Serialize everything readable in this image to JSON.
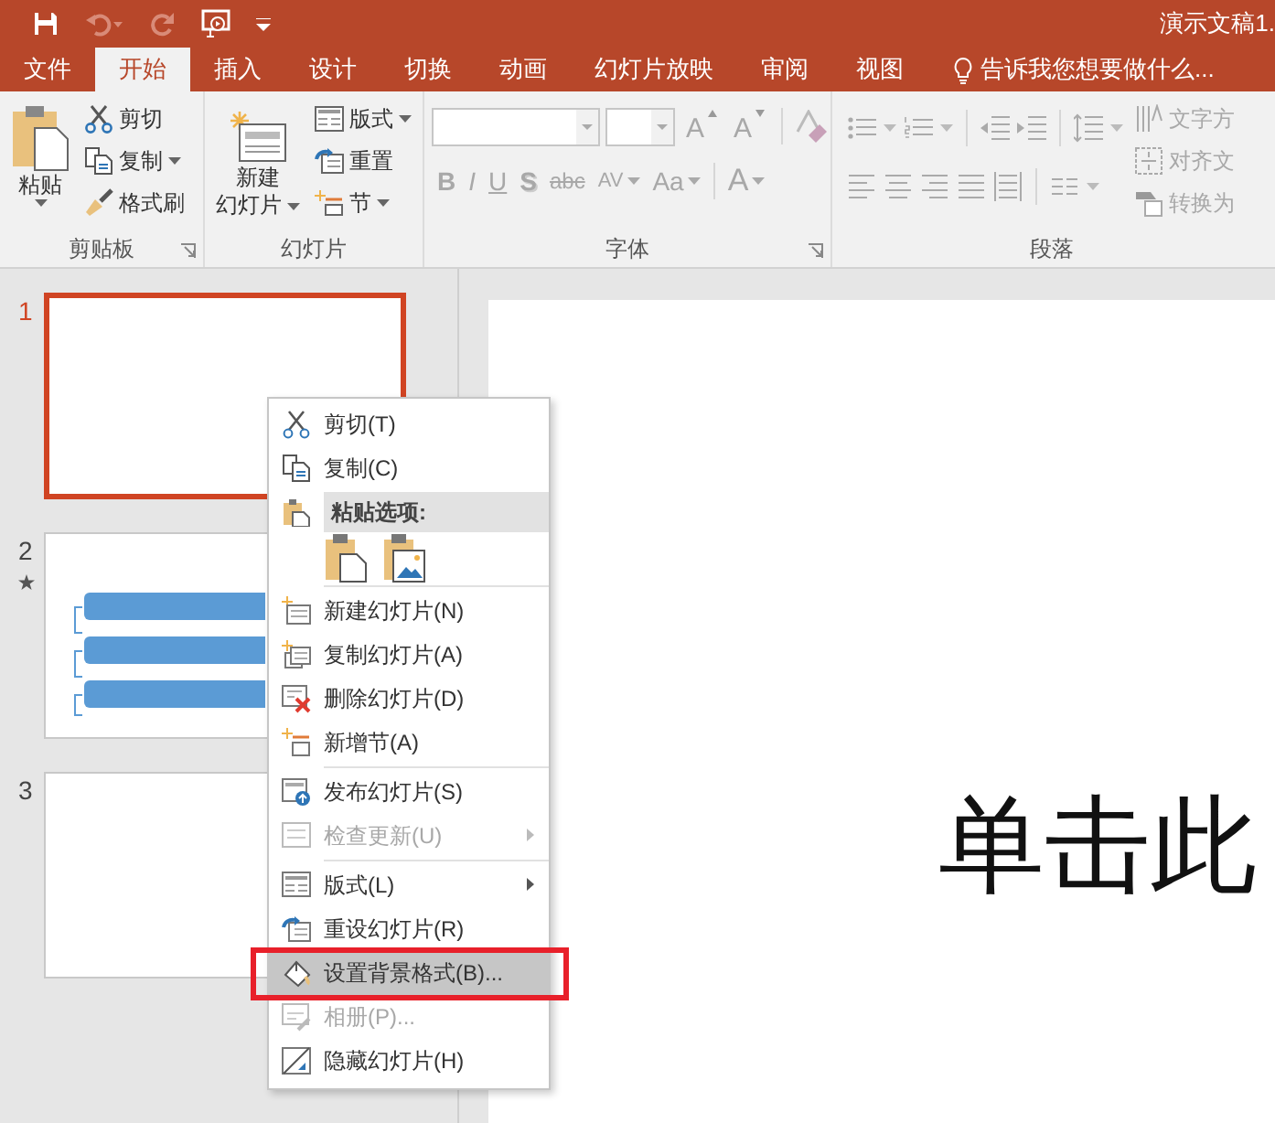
{
  "title_bar": {
    "title": "演示文稿1."
  },
  "tabs": [
    {
      "label": "文件",
      "selected": false
    },
    {
      "label": "开始",
      "selected": true
    },
    {
      "label": "插入",
      "selected": false
    },
    {
      "label": "设计",
      "selected": false
    },
    {
      "label": "切换",
      "selected": false
    },
    {
      "label": "动画",
      "selected": false
    },
    {
      "label": "幻灯片放映",
      "selected": false
    },
    {
      "label": "审阅",
      "selected": false
    },
    {
      "label": "视图",
      "selected": false
    }
  ],
  "tell_me": {
    "placeholder": "告诉我您想要做什么..."
  },
  "ribbon": {
    "clipboard": {
      "label": "剪贴板",
      "paste": "粘贴",
      "buttons": [
        {
          "label": "剪切",
          "dropdown": false
        },
        {
          "label": "复制",
          "dropdown": true
        },
        {
          "label": "格式刷",
          "dropdown": false
        }
      ]
    },
    "slides": {
      "label": "幻灯片",
      "new_slide": [
        "新建",
        "幻灯片"
      ],
      "buttons": [
        {
          "label": "版式",
          "dropdown": true
        },
        {
          "label": "重置",
          "dropdown": false
        },
        {
          "label": "节",
          "dropdown": true
        }
      ]
    },
    "font": {
      "label": "字体",
      "disabled": true,
      "size_buttons": [
        {
          "label": "A",
          "kind": "grow"
        },
        {
          "label": "A",
          "kind": "shrink"
        }
      ],
      "format_buttons": [
        {
          "label": "B",
          "kind": "bold"
        },
        {
          "label": "I",
          "kind": "italic"
        },
        {
          "label": "U",
          "kind": "underline"
        },
        {
          "label": "S",
          "kind": "shadow"
        },
        {
          "label": "abc",
          "kind": "strike"
        },
        {
          "label": "AV",
          "kind": "spacing"
        },
        {
          "label": "Aa",
          "kind": "case"
        },
        {
          "label": "A",
          "kind": "color"
        }
      ]
    },
    "paragraph": {
      "label": "段落",
      "disabled": true,
      "buttons": [
        {
          "label": "文字方"
        },
        {
          "label": "对齐文"
        },
        {
          "label": "转换为"
        }
      ]
    }
  },
  "slides_pane": [
    {
      "number": "1",
      "selected": true,
      "animated": false,
      "kind": "blank"
    },
    {
      "number": "2",
      "selected": false,
      "animated": true,
      "kind": "diagram"
    },
    {
      "number": "3",
      "selected": false,
      "animated": false,
      "kind": "blank"
    }
  ],
  "slide": {
    "placeholder": "单击此"
  },
  "context_menu": [
    {
      "kind": "item",
      "label": "剪切(T)",
      "disabled": false,
      "selected": false,
      "outlined": false,
      "submenu": false
    },
    {
      "kind": "item",
      "label": "复制(C)",
      "disabled": false,
      "selected": false,
      "outlined": false,
      "submenu": false
    },
    {
      "kind": "header",
      "label": "粘贴选项:"
    },
    {
      "kind": "paste-options"
    },
    {
      "kind": "separator"
    },
    {
      "kind": "item",
      "label": "新建幻灯片(N)",
      "disabled": false,
      "selected": false,
      "outlined": false,
      "submenu": false
    },
    {
      "kind": "item",
      "label": "复制幻灯片(A)",
      "disabled": false,
      "selected": false,
      "outlined": false,
      "submenu": false
    },
    {
      "kind": "item",
      "label": "删除幻灯片(D)",
      "disabled": false,
      "selected": false,
      "outlined": false,
      "submenu": false
    },
    {
      "kind": "item",
      "label": "新增节(A)",
      "disabled": false,
      "selected": false,
      "outlined": false,
      "submenu": false
    },
    {
      "kind": "separator"
    },
    {
      "kind": "item",
      "label": "发布幻灯片(S)",
      "disabled": false,
      "selected": false,
      "outlined": false,
      "submenu": false
    },
    {
      "kind": "item",
      "label": "检查更新(U)",
      "disabled": true,
      "selected": false,
      "outlined": false,
      "submenu": true
    },
    {
      "kind": "separator"
    },
    {
      "kind": "item",
      "label": "版式(L)",
      "disabled": false,
      "selected": false,
      "outlined": false,
      "submenu": true
    },
    {
      "kind": "item",
      "label": "重设幻灯片(R)",
      "disabled": false,
      "selected": false,
      "outlined": false,
      "submenu": false
    },
    {
      "kind": "item",
      "label": "设置背景格式(B)...",
      "disabled": false,
      "selected": true,
      "outlined": true,
      "submenu": false
    },
    {
      "kind": "item",
      "label": "相册(P)...",
      "disabled": true,
      "selected": false,
      "outlined": false,
      "submenu": false
    },
    {
      "kind": "item",
      "label": "隐藏幻灯片(H)",
      "disabled": false,
      "selected": false,
      "outlined": false,
      "submenu": false
    }
  ]
}
